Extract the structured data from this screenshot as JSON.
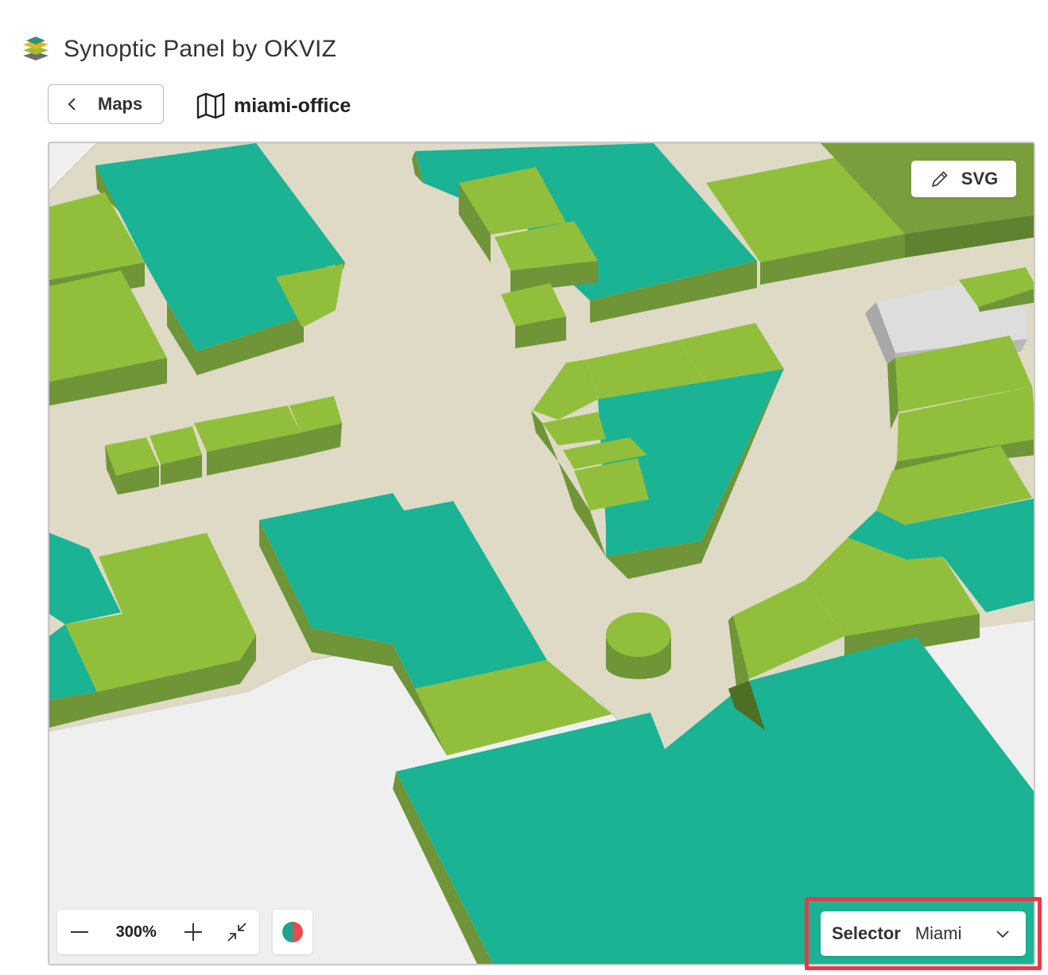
{
  "app": {
    "title": "Synoptic Panel by OKVIZ",
    "logo_icon": "layers-logo-icon"
  },
  "nav": {
    "back_label": "Maps",
    "back_icon": "chevron-left-icon"
  },
  "map": {
    "name": "miami-office",
    "map_icon": "map-icon"
  },
  "toolbar": {
    "svg_label": "SVG",
    "svg_icon": "pencil-icon"
  },
  "zoom": {
    "value": "300%",
    "zoom_out_icon": "minus-icon",
    "zoom_in_icon": "plus-icon",
    "fit_icon": "collapse-arrows-icon"
  },
  "color_toggle": {
    "icon": "color-state-icon",
    "colors": [
      "#1aa68f",
      "#e84c4c"
    ]
  },
  "selector": {
    "label": "Selector",
    "value": "Miami",
    "icon": "chevron-down-icon"
  },
  "palette": {
    "teal": "#1ab394",
    "light_green": "#92bf3b",
    "dark_green": "#6f9538",
    "floor": "#dedac6",
    "empty": "#efefef",
    "gray_block": "#d8d8d8",
    "highlight": "#e83a4b"
  }
}
